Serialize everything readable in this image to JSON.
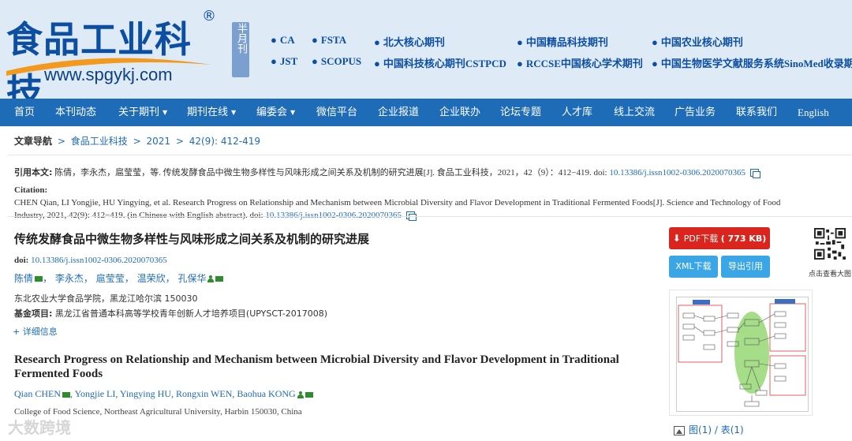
{
  "header": {
    "logo_text": "食品工业科技",
    "logo_reg": "®",
    "logo_url": "www.spgykj.com",
    "badge": "半月刊",
    "links_row1": [
      {
        "label": "CA"
      },
      {
        "label": "FSTA"
      },
      {
        "label": "北大核心期刊"
      },
      {
        "label": "中国精品科技期刊"
      },
      {
        "label": "中国农业核心期刊"
      }
    ],
    "links_row2": [
      {
        "label": "JST"
      },
      {
        "label": "SCOPUS"
      },
      {
        "label": "中国科技核心期刊CSTPCD"
      },
      {
        "label": "RCCSE中国核心学术期刊"
      },
      {
        "label": "中国生物医学文献服务系统SinoMed收录期刊"
      }
    ],
    "colors": {
      "brand": "#0b4ea2",
      "header_bg": "#dfeaf7",
      "nav_bg": "#1e6bb8"
    }
  },
  "nav": {
    "items": [
      {
        "label": "首页",
        "has_caret": false
      },
      {
        "label": "本刊动态",
        "has_caret": false
      },
      {
        "label": "关于期刊",
        "has_caret": true
      },
      {
        "label": "期刊在线",
        "has_caret": true
      },
      {
        "label": "编委会",
        "has_caret": true
      },
      {
        "label": "微信平台",
        "has_caret": false
      },
      {
        "label": "企业报道",
        "has_caret": false
      },
      {
        "label": "企业联办",
        "has_caret": false
      },
      {
        "label": "论坛专题",
        "has_caret": false
      },
      {
        "label": "人才库",
        "has_caret": false
      },
      {
        "label": "线上交流",
        "has_caret": false
      },
      {
        "label": "广告业务",
        "has_caret": false
      },
      {
        "label": "联系我们",
        "has_caret": false
      },
      {
        "label": "English",
        "has_caret": false
      }
    ]
  },
  "breadcrumb": {
    "label": "文章导航",
    "sep": ">",
    "journal": "食品工业科技",
    "year": "2021",
    "issue": "42(9): 412-419"
  },
  "citation": {
    "cn_label": "引用本文:",
    "cn_text": "陈倩，李永杰，扈莹莹，等. 传统发酵食品中微生物多样性与风味形成之间关系及机制的研究进展[J]. 食品工业科技，2021，42（9）：412−419. doi: ",
    "en_label": "Citation:",
    "en_text": "CHEN Qian, LI Yongjie, HU Yingying, et al. Research Progress on Relationship and Mechanism between Microbial Diversity and Flavor Development in Traditional Fermented Foods[J]. Science and Technology of Food Industry, 2021, 42(9): 412−419. (in Chinese with English abstract). doi: ",
    "doi": "10.13386/j.issn1002-0306.2020070365"
  },
  "article": {
    "title_cn": "传统发酵食品中微生物多样性与风味形成之间关系及机制的研究进展",
    "doi_label": "doi:",
    "doi": "10.13386/j.issn1002-0306.2020070365",
    "authors_cn": [
      "陈倩",
      "李永杰",
      "扈莹莹",
      "温荣欣",
      "孔保华"
    ],
    "comma_cn": "，",
    "affiliation_cn": "东北农业大学食品学院，黑龙江哈尔滨 150030",
    "fund_label": "基金项目:",
    "fund_text": "黑龙江省普通本科高等学校青年创新人才培养项目(UPYSCT-2017008)",
    "more_label": "+ 详细信息",
    "title_en": "Research Progress on Relationship and Mechanism between Microbial Diversity and Flavor Development in Traditional Fermented Foods",
    "authors_en": [
      "Qian CHEN",
      "Yongjie LI",
      "Yingying HU",
      "Rongxin WEN",
      "Baohua KONG"
    ],
    "comma_en": ",",
    "affiliation_en": "College of Food Science, Northeast Agricultural University, Harbin 150030, China"
  },
  "sidebar": {
    "pdf_label": "PDF下载",
    "pdf_size": "( 773 KB)",
    "xml_label": "XML下载",
    "export_label": "导出引用",
    "qr_caption": "点击查看大图",
    "fig_label": "图",
    "fig_count": "(1)",
    "fig_sep": " / ",
    "table_label": "表",
    "table_count": "(1)"
  },
  "watermark": "大数跨境"
}
